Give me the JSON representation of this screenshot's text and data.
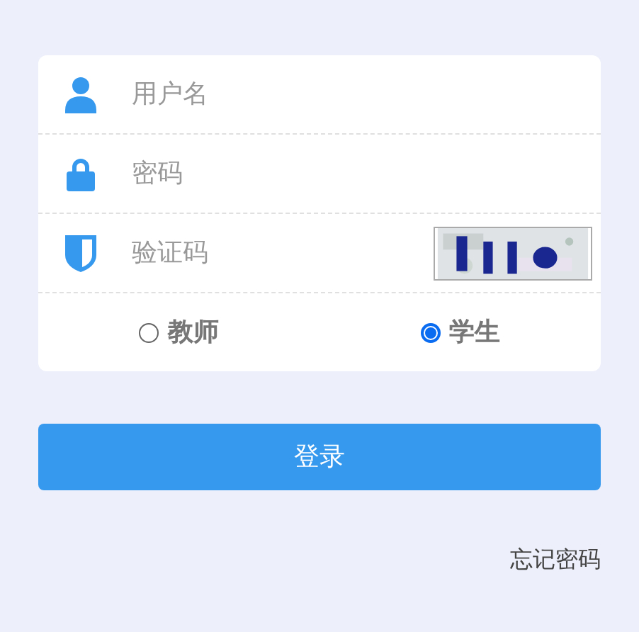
{
  "fields": [
    {
      "kind": "user",
      "placeholder": "用户名"
    },
    {
      "kind": "password",
      "placeholder": "密码"
    },
    {
      "kind": "captcha",
      "placeholder": "验证码"
    }
  ],
  "roles": [
    {
      "label": "教师",
      "selected": false
    },
    {
      "label": "学生",
      "selected": true
    }
  ],
  "login_button": "登录",
  "forgot_link": "忘记密码"
}
